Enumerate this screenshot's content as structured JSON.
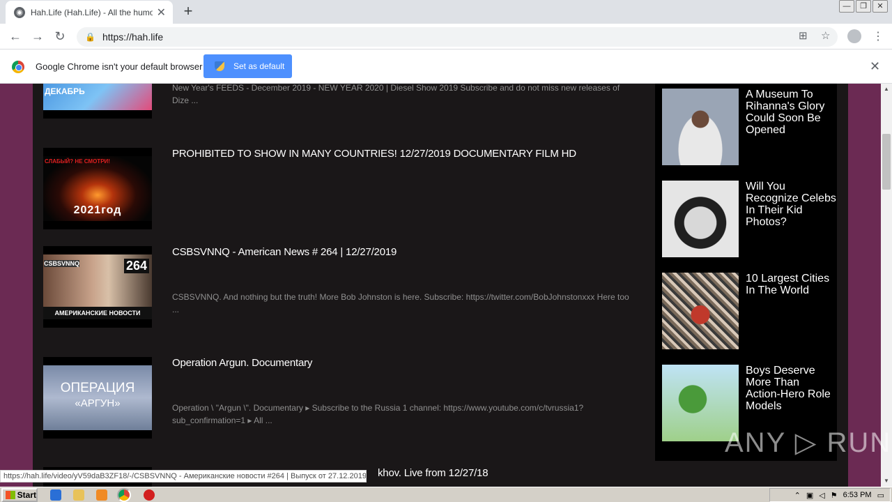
{
  "browser": {
    "tab_title": "Hah.Life (Hah.Life) - All the humor in",
    "tab_close": "✕",
    "new_tab": "+",
    "url": "https://hah.life",
    "window_buttons": [
      "—",
      "❐",
      "✕"
    ]
  },
  "infobar": {
    "message": "Google Chrome isn't your default browser",
    "button": "Set as default",
    "close": "✕"
  },
  "videos": [
    {
      "title": "",
      "description": "New Year's FEEDS - December 2019 - NEW YEAR 2020 | Diesel Show 2019 Subscribe and do not miss new releases of Dize ...",
      "thumb_text": "ДЕКАБРЬ"
    },
    {
      "title": "PROHIBITED TO SHOW IN MANY COUNTRIES! 12/27/2019 DOCUMENTARY FILM HD",
      "description": "",
      "thumb_text": "2021год",
      "thumb_top": "СЛАБЫЙ? НЕ СМОТРИ!"
    },
    {
      "title": "CSBSVNNQ - American News # 264 | 12/27/2019",
      "description": "CSBSVNNQ. And nothing but the truth! More Bob Johnston is here. Subscribe: https://twitter.com/BobJohnstonxxx Here too ...",
      "thumb_text": "АМЕРИКАНСКИЕ НОВОСТИ",
      "thumb_top": "CSBSVNNQ",
      "thumb_num": "264"
    },
    {
      "title": "Operation Argun. Documentary",
      "description": "Operation \\ \"Argun \\\". Documentary ▸ Subscribe to the Russia 1 channel: https://www.youtube.com/c/tvrussia1?sub_confirmation=1 ▸ All ...",
      "thumb_text": "ОПЕРАЦИЯ",
      "thumb_sub": "«АРГУН»"
    },
    {
      "title": "khov. Live from 12/27/18",
      "description": ""
    }
  ],
  "sidebar": [
    {
      "title": "A Museum To Rihanna's Glory Could Soon Be Opened"
    },
    {
      "title": "Will You Recognize Celebs In Their Kid Photos?"
    },
    {
      "title": "10 Largest Cities In The World"
    },
    {
      "title": "Boys Deserve More Than Action-Hero Role Models"
    }
  ],
  "status_url": "https://hah.life/video/yV59daB3ZF18/-/CSBSVNNQ - Американские новости #264 | Выпуск от 27.12.2019",
  "watermark": "ANY ▷ RUN",
  "taskbar": {
    "start": "Start",
    "clock": "6:53 PM"
  },
  "colors": {
    "page_bg": "#6b2a53",
    "content_bg": "#1a1718",
    "button_blue": "#4d90fe"
  }
}
